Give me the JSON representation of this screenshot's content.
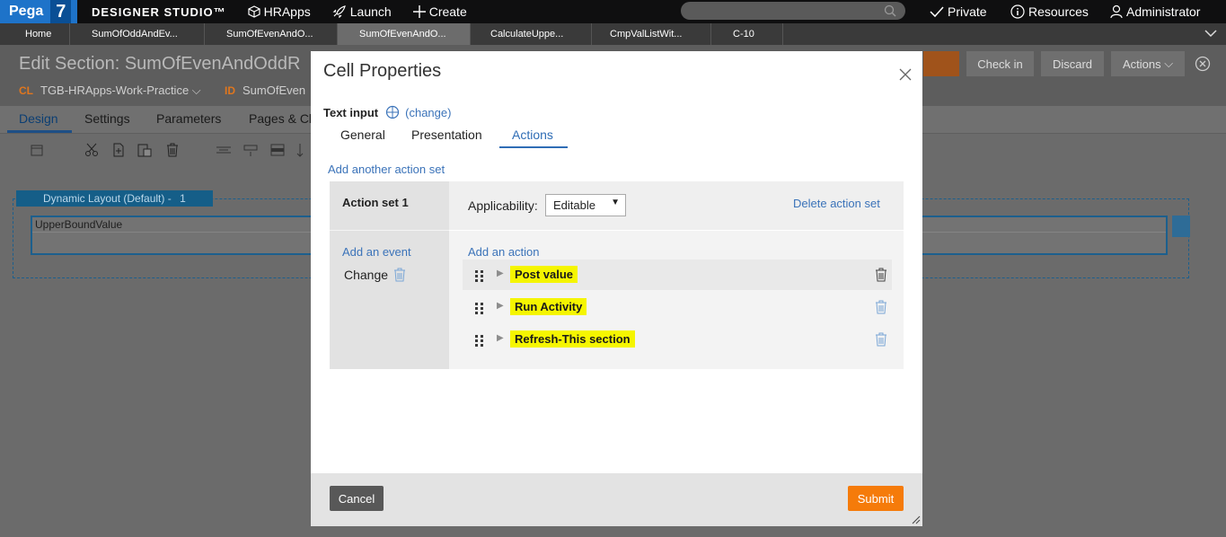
{
  "topbar": {
    "logo": "Pega",
    "logo_version": "7",
    "studio_title": "DESIGNER STUDIO™",
    "app_name": "HRApps",
    "launch": "Launch",
    "create": "Create",
    "private": "Private",
    "resources": "Resources",
    "user": "Administrator"
  },
  "tabs": [
    {
      "label": "Home"
    },
    {
      "label": "SumOfOddAndEv..."
    },
    {
      "label": "SumOfEvenAndO..."
    },
    {
      "label": "SumOfEvenAndO..."
    },
    {
      "label": "CalculateUppe..."
    },
    {
      "label": "CmpValListWit..."
    },
    {
      "label": "C-10"
    }
  ],
  "edit_section": {
    "title": "Edit Section: SumOfEvenAndOddR",
    "cl_key": "CL",
    "cl_value": "TGB-HRApps-Work-Practice",
    "id_key": "ID",
    "id_value": "SumOfEven",
    "check_in": "Check in",
    "discard": "Discard",
    "actions": "Actions"
  },
  "design_tabs": [
    "Design",
    "Settings",
    "Parameters",
    "Pages & Cl"
  ],
  "canvas": {
    "layout_label": "Dynamic Layout (Default) -",
    "layout_count": "1",
    "field_label": "UpperBoundValue"
  },
  "modal": {
    "title": "Cell Properties",
    "field_type": "Text input",
    "change_link": "(change)",
    "tabs": [
      "General",
      "Presentation",
      "Actions"
    ],
    "active_tab": "Actions",
    "add_action_set": "Add another action set",
    "action_set": {
      "title": "Action set 1",
      "applicability_label": "Applicability:",
      "applicability_value": "Editable",
      "delete_link": "Delete action set",
      "add_event": "Add an event",
      "event": "Change",
      "add_action": "Add an action",
      "actions": [
        {
          "label": "Post value"
        },
        {
          "label": "Run Activity"
        },
        {
          "label": "Refresh-This section"
        }
      ]
    },
    "cancel": "Cancel",
    "submit": "Submit"
  },
  "colors": {
    "accent_blue": "#3b73b9",
    "submit_orange": "#f57b0a",
    "highlight_yellow": "#f5f500"
  }
}
